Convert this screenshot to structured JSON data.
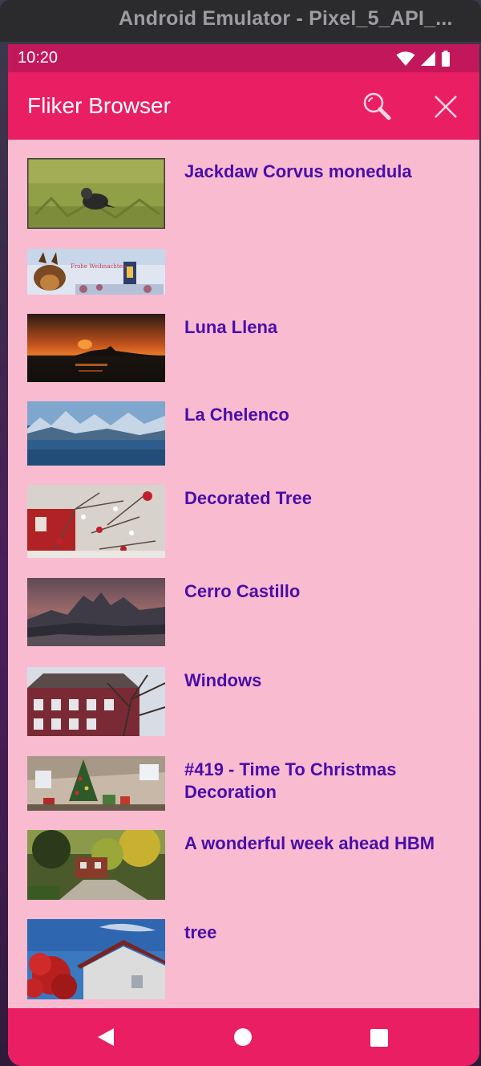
{
  "window": {
    "title": "Android Emulator - Pixel_5_API_..."
  },
  "status_bar": {
    "time": "10:20",
    "icons": [
      "wifi-icon",
      "signal-icon",
      "battery-icon"
    ]
  },
  "app_bar": {
    "title": "Fliker Browser",
    "actions": [
      "search-icon",
      "close-icon"
    ]
  },
  "photos": [
    {
      "title": "Jackdaw Corvus monedula"
    },
    {
      "title": ""
    },
    {
      "title": "Luna Llena"
    },
    {
      "title": "La Chelenco"
    },
    {
      "title": "Decorated Tree"
    },
    {
      "title": "Cerro Castillo"
    },
    {
      "title": "Windows"
    },
    {
      "title": "#419 - Time To Christmas Decoration"
    },
    {
      "title": "A wonderful week ahead HBM"
    },
    {
      "title": "tree"
    }
  ],
  "thumbnail_overlay": {
    "text": "Frohe Weihnachten"
  },
  "nav_bar": {
    "buttons": [
      "back-icon",
      "home-icon",
      "recents-icon"
    ]
  },
  "colors": {
    "status_bar": "#c2185b",
    "app_bar": "#e91e63",
    "list_background": "#f8bbd0",
    "title_text": "#4a0ea8"
  }
}
